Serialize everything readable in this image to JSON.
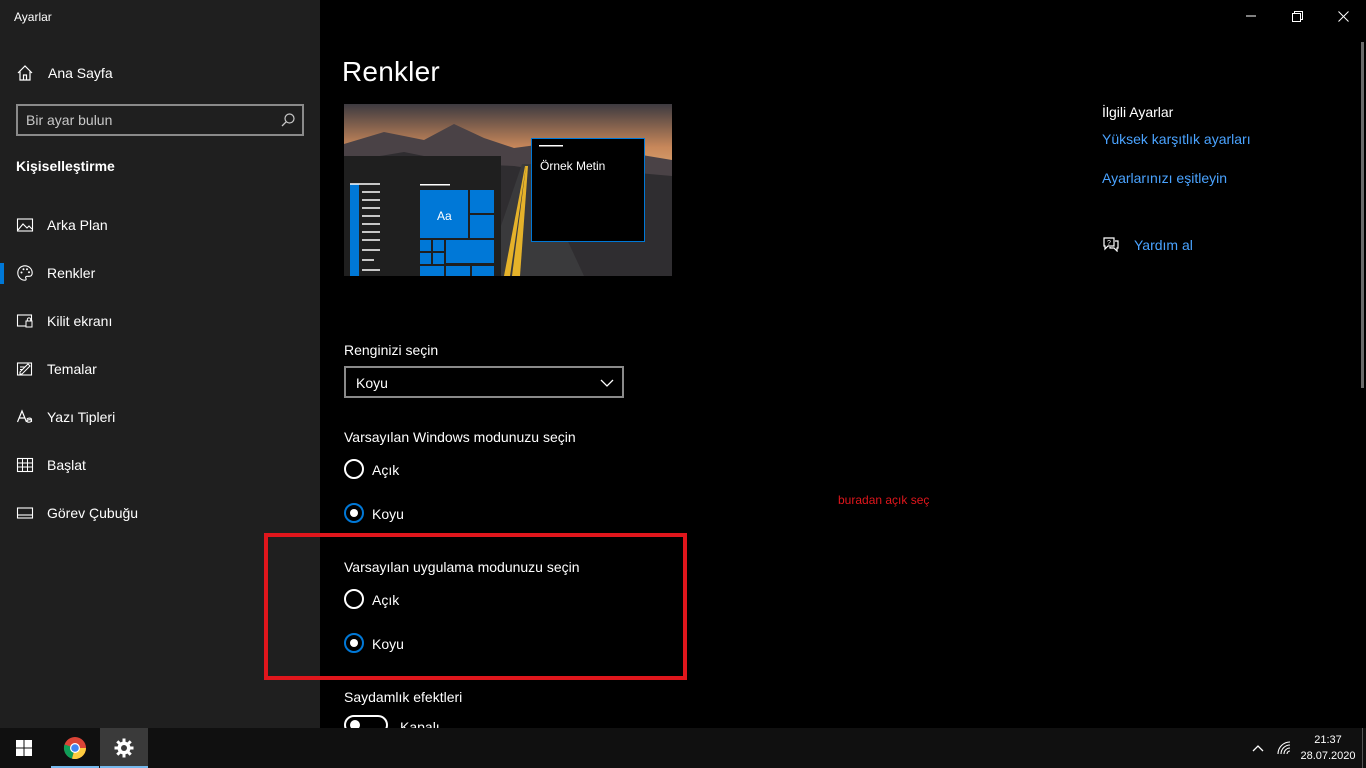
{
  "window": {
    "title": "Ayarlar"
  },
  "sidebar": {
    "home_label": "Ana Sayfa",
    "search_placeholder": "Bir ayar bulun",
    "section_heading": "Kişiselleştirme",
    "items": [
      {
        "label": "Arka Plan",
        "icon": "image-icon"
      },
      {
        "label": "Renkler",
        "icon": "palette-icon",
        "active": true
      },
      {
        "label": "Kilit ekranı",
        "icon": "lock-screen-icon"
      },
      {
        "label": "Temalar",
        "icon": "theme-icon"
      },
      {
        "label": "Yazı Tipleri",
        "icon": "font-icon"
      },
      {
        "label": "Başlat",
        "icon": "start-icon"
      },
      {
        "label": "Görev Çubuğu",
        "icon": "taskbar-icon"
      }
    ]
  },
  "main": {
    "page_title": "Renkler",
    "preview": {
      "sample_text": "Örnek Metin",
      "tile_text": "Aa"
    },
    "color_choice": {
      "label": "Renginizi seçin",
      "value": "Koyu"
    },
    "windows_mode": {
      "label": "Varsayılan Windows modunuzu seçin",
      "options": [
        "Açık",
        "Koyu"
      ],
      "selected": "Koyu"
    },
    "app_mode": {
      "label": "Varsayılan uygulama modunuzu seçin",
      "options": [
        "Açık",
        "Koyu"
      ],
      "selected": "Koyu"
    },
    "transparency": {
      "label": "Saydamlık efektleri",
      "state_label": "Kapalı",
      "on": false
    }
  },
  "annotation": {
    "text": "buradan açık seç",
    "color": "#e0161c"
  },
  "related": {
    "heading": "İlgili Ayarlar",
    "links": [
      "Yüksek karşıtlık ayarları",
      "Ayarlarınızı eşitleyin"
    ],
    "help_label": "Yardım al"
  },
  "taskbar": {
    "time": "21:37",
    "date": "28.07.2020",
    "apps": [
      "chrome-icon",
      "settings-gear-icon"
    ]
  },
  "colors": {
    "accent": "#0078d7",
    "link": "#4aa3ff",
    "sidebar_bg": "#1f1f1f",
    "annotation": "#e0161c"
  }
}
